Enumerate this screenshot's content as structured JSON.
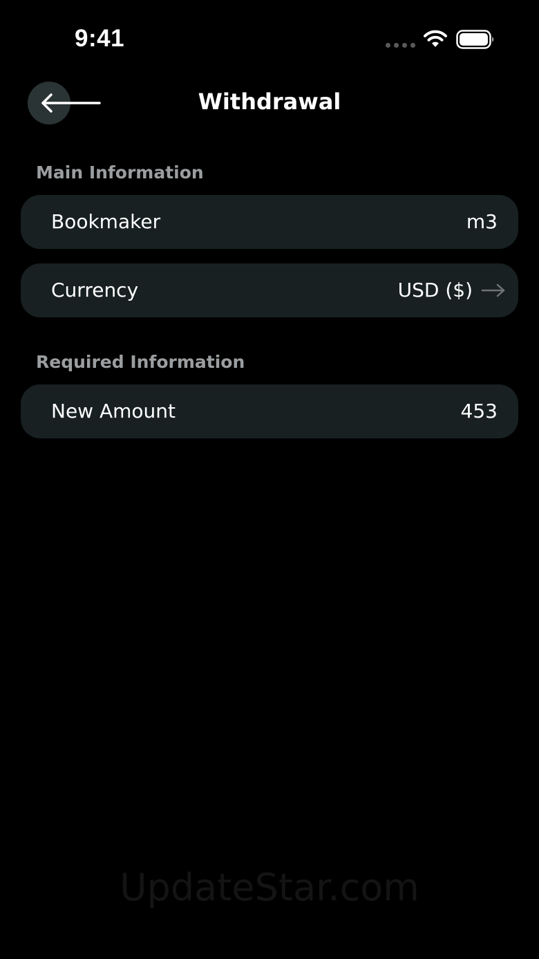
{
  "status_bar": {
    "time": "9:41"
  },
  "nav": {
    "title": "Withdrawal",
    "back_icon": "arrow-left-icon"
  },
  "sections": {
    "main": {
      "header": "Main Information",
      "bookmaker_label": "Bookmaker",
      "bookmaker_value": "m3",
      "currency_label": "Currency",
      "currency_value": "USD ($)",
      "currency_icon": "arrow-right-icon"
    },
    "required": {
      "header": "Required Information",
      "amount_label": "New Amount",
      "amount_value": "453"
    }
  },
  "watermark": "UpdateStar.com",
  "colors": {
    "background": "#000000",
    "card": "#182022",
    "back_button": "#2b3434",
    "section_header": "#9b9ea0",
    "text": "#ffffff"
  }
}
